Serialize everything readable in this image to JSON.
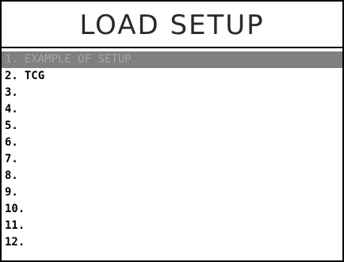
{
  "screen": {
    "title": "LOAD SETUP"
  },
  "setups": [
    {
      "number": "1.",
      "name": "EXAMPLE OF SETUP",
      "selected": true
    },
    {
      "number": "2.",
      "name": "TCG",
      "selected": false
    },
    {
      "number": "3.",
      "name": "",
      "selected": false
    },
    {
      "number": "4.",
      "name": "",
      "selected": false
    },
    {
      "number": "5.",
      "name": "",
      "selected": false
    },
    {
      "number": "6.",
      "name": "",
      "selected": false
    },
    {
      "number": "7.",
      "name": "",
      "selected": false
    },
    {
      "number": "8.",
      "name": "",
      "selected": false
    },
    {
      "number": "9.",
      "name": "",
      "selected": false
    },
    {
      "number": "10.",
      "name": "",
      "selected": false
    },
    {
      "number": "11.",
      "name": "",
      "selected": false
    },
    {
      "number": "12.",
      "name": "",
      "selected": false
    }
  ],
  "colors": {
    "selected_background": "#808080",
    "selected_text": "#a6a6a6",
    "text": "#000000",
    "border": "#000000"
  }
}
